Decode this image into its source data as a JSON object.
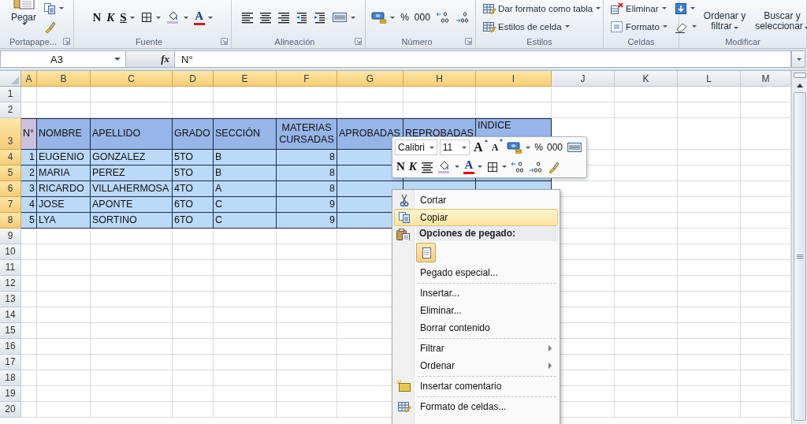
{
  "ribbon": {
    "groups": [
      {
        "label": "Portapape...",
        "launcher": true,
        "columns": [
          [
            {
              "kind": "paste",
              "label": "Pegar",
              "dropdown": true
            }
          ],
          [
            {
              "kind": "copy",
              "dropdown": true
            },
            {
              "kind": "painter"
            }
          ]
        ]
      },
      {
        "label": "Fuente",
        "launcher": true,
        "columns": [
          [
            {
              "kind": "bold",
              "label": "N"
            }
          ],
          [
            {
              "kind": "italic",
              "label": "K"
            }
          ],
          [
            {
              "kind": "underline",
              "label": "S",
              "dropdown": true
            }
          ],
          [
            {
              "kind": "borders",
              "dropdown": true
            }
          ],
          [
            {
              "kind": "fill",
              "dropdown": true
            }
          ],
          [
            {
              "kind": "font-color",
              "label": "A",
              "dropdown": true
            }
          ]
        ]
      },
      {
        "label": "Alineación",
        "launcher": true,
        "columns": [
          [
            {
              "kind": "align-left"
            }
          ],
          [
            {
              "kind": "align-center"
            }
          ],
          [
            {
              "kind": "align-right"
            }
          ],
          [
            {
              "kind": "outdent"
            }
          ],
          [
            {
              "kind": "indent"
            }
          ],
          [
            {
              "kind": "merge",
              "dropdown": true
            }
          ]
        ]
      },
      {
        "label": "Número",
        "launcher": true,
        "columns": [
          [
            {
              "kind": "currency",
              "dropdown": true
            }
          ],
          [
            {
              "kind": "percent",
              "label": "%"
            }
          ],
          [
            {
              "kind": "thousands",
              "label": "000"
            }
          ],
          [
            {
              "kind": "dec-inc"
            }
          ],
          [
            {
              "kind": "dec-dec"
            }
          ]
        ]
      },
      {
        "label": "Estilos",
        "columns": [
          [
            {
              "kind": "table-format",
              "label": "Dar formato como tabla",
              "dropdown": true
            },
            {
              "kind": "cell-styles",
              "label": "Estilos de celda",
              "dropdown": true
            }
          ]
        ]
      },
      {
        "label": "Celdas",
        "columns": [
          [
            {
              "kind": "delete",
              "label": "Eliminar",
              "dropdown": true
            },
            {
              "kind": "format",
              "label": "Formato",
              "dropdown": true
            }
          ]
        ]
      },
      {
        "label": "Modificar",
        "columns": [
          [
            {
              "kind": "fill-down",
              "dropdown": true
            },
            {
              "kind": "clear",
              "dropdown": true
            }
          ],
          [
            {
              "kind": "sort",
              "label": "Ordenar y filtrar",
              "dropdown": true
            }
          ],
          [
            {
              "kind": "find",
              "label": "Buscar y seleccionar",
              "dropdown": true
            }
          ]
        ]
      }
    ]
  },
  "formula_bar": {
    "name_box": "A3",
    "function_label": "fx",
    "value": "N°"
  },
  "sheet": {
    "columns": [
      {
        "label": "A",
        "selected": true
      },
      {
        "label": "B",
        "selected": true
      },
      {
        "label": "C",
        "selected": true
      },
      {
        "label": "D",
        "selected": true
      },
      {
        "label": "E",
        "selected": true
      },
      {
        "label": "F",
        "selected": true
      },
      {
        "label": "G",
        "selected": true
      },
      {
        "label": "H",
        "selected": true
      },
      {
        "label": "I",
        "selected": true
      },
      {
        "label": "J",
        "selected": false
      },
      {
        "label": "K",
        "selected": false
      },
      {
        "label": "L",
        "selected": false
      },
      {
        "label": "M",
        "selected": false
      }
    ],
    "rows": [
      {
        "label": "1",
        "selected": false
      },
      {
        "label": "2",
        "selected": false
      },
      {
        "label": "3",
        "selected": true,
        "kind": "header",
        "cells": [
          "N°",
          "NOMBRE",
          "APELLIDO",
          "GRADO",
          "SECCIÓN",
          "MATERIAS CURSADAS",
          "APROBADAS",
          "REPROBADAS",
          "INDICE"
        ]
      },
      {
        "label": "4",
        "selected": true,
        "kind": "data",
        "cells": [
          "1",
          "EUGENIO",
          "GONZALEZ",
          "5TO",
          "B",
          "8",
          null,
          null,
          null
        ]
      },
      {
        "label": "5",
        "selected": true,
        "kind": "data",
        "cells": [
          "2",
          "MARIA",
          "PEREZ",
          "5TO",
          "B",
          "8",
          null,
          null,
          null
        ]
      },
      {
        "label": "6",
        "selected": true,
        "kind": "data",
        "cells": [
          "3",
          "RICARDO",
          "VILLAHERMOSA",
          "4TO",
          "A",
          "8",
          null,
          null,
          null
        ]
      },
      {
        "label": "7",
        "selected": true,
        "kind": "data",
        "cells": [
          "4",
          "JOSE",
          "APONTE",
          "6TO",
          "C",
          "9",
          null,
          null,
          null
        ]
      },
      {
        "label": "8",
        "selected": true,
        "kind": "data",
        "cells": [
          "5",
          "LYA",
          "SORTINO",
          "6TO",
          "C",
          "9",
          null,
          null,
          null
        ]
      },
      {
        "label": "9",
        "selected": false
      },
      {
        "label": "10",
        "selected": false
      },
      {
        "label": "11",
        "selected": false
      },
      {
        "label": "12",
        "selected": false
      },
      {
        "label": "13",
        "selected": false
      },
      {
        "label": "14",
        "selected": false
      },
      {
        "label": "15",
        "selected": false
      },
      {
        "label": "16",
        "selected": false
      },
      {
        "label": "17",
        "selected": false
      },
      {
        "label": "18",
        "selected": false
      },
      {
        "label": "19",
        "selected": false
      },
      {
        "label": "20",
        "selected": false
      }
    ]
  },
  "mini_toolbar": {
    "font": "Calibri",
    "size": "11",
    "rows": [
      [
        {
          "kind": "grow-font",
          "label": "A"
        },
        {
          "kind": "shrink-font",
          "label": "A"
        },
        {
          "kind": "currency",
          "dropdown": true
        },
        {
          "kind": "percent",
          "label": "%"
        },
        {
          "kind": "thousands",
          "label": "000"
        },
        {
          "kind": "merge"
        }
      ],
      [
        {
          "kind": "bold",
          "label": "N"
        },
        {
          "kind": "italic",
          "label": "K"
        },
        {
          "kind": "align-center"
        },
        {
          "kind": "fill",
          "dropdown": true
        },
        {
          "kind": "font-color",
          "label": "A",
          "dropdown": true
        },
        {
          "kind": "borders",
          "dropdown": true
        },
        {
          "kind": "dec-inc"
        },
        {
          "kind": "dec-dec"
        },
        {
          "kind": "painter"
        }
      ]
    ]
  },
  "context_menu": {
    "items": [
      {
        "kind": "cut",
        "label": "Cortar",
        "selected": false
      },
      {
        "kind": "copy",
        "label": "Copiar",
        "selected": true
      },
      {
        "kind": "header",
        "label": "Opciones de pegado:"
      },
      {
        "kind": "paste-buttons"
      },
      {
        "kind": "plain",
        "label": "Pegado especial...",
        "selected": false
      },
      {
        "kind": "separator"
      },
      {
        "kind": "plain",
        "label": "Insertar...",
        "selected": false
      },
      {
        "kind": "plain",
        "label": "Eliminar...",
        "selected": false
      },
      {
        "kind": "plain",
        "label": "Borrar contenido",
        "selected": false
      },
      {
        "kind": "separator"
      },
      {
        "kind": "submenu",
        "label": "Filtrar",
        "selected": false
      },
      {
        "kind": "submenu",
        "label": "Ordenar",
        "selected": false
      },
      {
        "kind": "separator"
      },
      {
        "kind": "comment",
        "label": "Insertar comentario",
        "selected": false
      },
      {
        "kind": "separator"
      },
      {
        "kind": "format-cells",
        "label": "Formato de celdas...",
        "selected": false
      }
    ]
  }
}
